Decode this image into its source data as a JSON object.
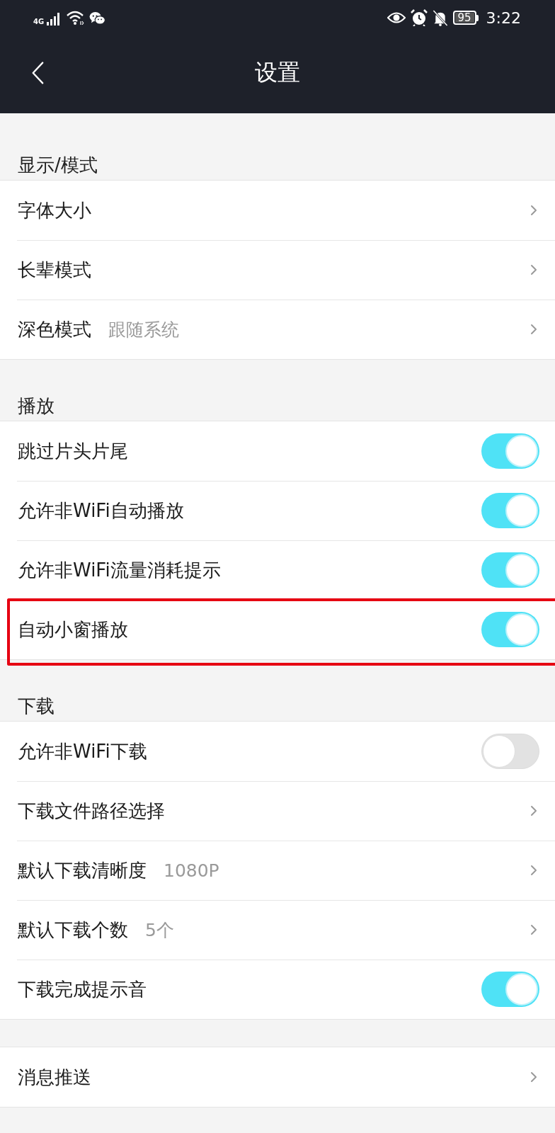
{
  "status_bar": {
    "network": "4G",
    "battery": "95",
    "time": "3:22"
  },
  "header": {
    "title": "设置"
  },
  "sections": [
    {
      "title": "显示/模式",
      "items": [
        {
          "kind": "link",
          "label": "字体大小",
          "highlighted": false
        },
        {
          "kind": "link",
          "label": "长辈模式",
          "highlighted": false
        },
        {
          "kind": "link",
          "label": "深色模式",
          "value": "跟随系统",
          "highlighted": false
        }
      ]
    },
    {
      "title": "播放",
      "items": [
        {
          "kind": "toggle",
          "label": "跳过片头片尾",
          "on": true,
          "highlighted": false
        },
        {
          "kind": "toggle",
          "label": "允许非WiFi自动播放",
          "on": true,
          "highlighted": false
        },
        {
          "kind": "toggle",
          "label": "允许非WiFi流量消耗提示",
          "on": true,
          "highlighted": false
        },
        {
          "kind": "toggle",
          "label": "自动小窗播放",
          "on": true,
          "highlighted": true
        }
      ]
    },
    {
      "title": "下载",
      "items": [
        {
          "kind": "toggle",
          "label": "允许非WiFi下载",
          "on": false,
          "highlighted": false
        },
        {
          "kind": "link",
          "label": "下载文件路径选择",
          "highlighted": false
        },
        {
          "kind": "link",
          "label": "默认下载清晰度",
          "value": "1080P",
          "highlighted": false
        },
        {
          "kind": "link",
          "label": "默认下载个数",
          "value": "5个",
          "highlighted": false
        },
        {
          "kind": "toggle",
          "label": "下载完成提示音",
          "on": true,
          "highlighted": false
        }
      ]
    },
    {
      "items": [
        {
          "kind": "link",
          "label": "消息推送",
          "highlighted": false
        }
      ]
    }
  ]
}
